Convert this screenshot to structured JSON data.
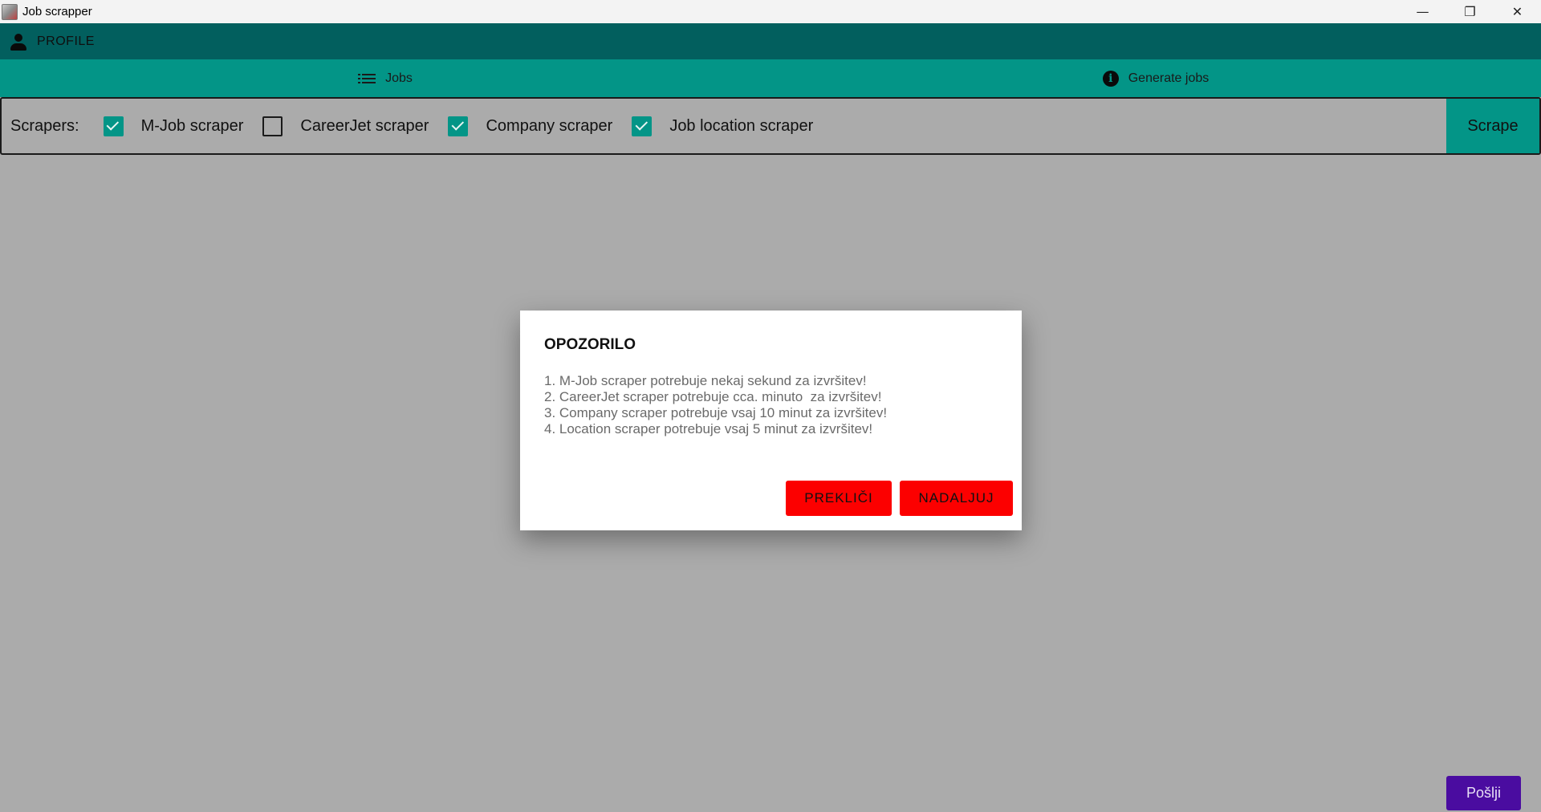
{
  "window": {
    "title": "Job scrapper",
    "controls": {
      "minimize": "—",
      "restore": "❐",
      "close": "✕"
    }
  },
  "profile": {
    "label": "PROFILE",
    "icon": "person-icon"
  },
  "tabs": [
    {
      "label": "Jobs",
      "icon": "list-icon"
    },
    {
      "label": "Generate jobs",
      "icon": "info-icon"
    }
  ],
  "scrapers": {
    "label": "Scrapers:",
    "items": [
      {
        "label": "M-Job scraper",
        "checked": true
      },
      {
        "label": "CareerJet scraper",
        "checked": false
      },
      {
        "label": "Company scraper",
        "checked": true
      },
      {
        "label": "Job location scraper",
        "checked": true
      }
    ],
    "scrape_button": "Scrape"
  },
  "dialog": {
    "title": "OPOZORILO",
    "lines": [
      "1. M-Job scraper potrebuje nekaj sekund za izvršitev!",
      "2. CareerJet scraper potrebuje cca. minuto  za izvršitev!",
      "3. Company scraper potrebuje vsaj 10 minut za izvršitev!",
      "4. Location scraper potrebuje vsaj 5 minut za izvršitev!"
    ],
    "cancel_button": "PREKLIČI",
    "continue_button": "NADALJUJ"
  },
  "send_button": "Pošlji",
  "colors": {
    "profile_bar": "#025f5e",
    "tab_bar": "#039587",
    "overlay_bg": "#ababab",
    "dialog_button": "#fc0000",
    "send_button": "#4a0ca0"
  }
}
